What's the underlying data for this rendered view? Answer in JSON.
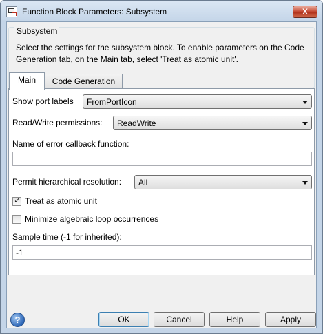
{
  "window": {
    "title": "Function Block Parameters: Subsystem",
    "close_glyph": "X"
  },
  "group": {
    "title": "Subsystem",
    "description": "Select the settings for the subsystem block. To enable parameters on the Code Generation tab, on the Main tab, select 'Treat as atomic unit'."
  },
  "tabs": [
    {
      "label": "Main",
      "active": true
    },
    {
      "label": "Code Generation",
      "active": false
    }
  ],
  "main": {
    "show_port_labels": {
      "label": "Show port labels",
      "value": "FromPortIcon"
    },
    "read_write_permissions": {
      "label": "Read/Write permissions:",
      "value": "ReadWrite"
    },
    "error_callback": {
      "label": "Name of error callback function:",
      "value": ""
    },
    "hierarchical_resolution": {
      "label": "Permit hierarchical resolution:",
      "value": "All"
    },
    "treat_atomic": {
      "label": "Treat as atomic unit",
      "checked": true
    },
    "minimize_loop": {
      "label": "Minimize algebraic loop occurrences",
      "checked": false
    },
    "sample_time": {
      "label": "Sample time (-1 for inherited):",
      "value": "-1"
    }
  },
  "buttons": {
    "help_glyph": "?",
    "ok": "OK",
    "cancel": "Cancel",
    "help": "Help",
    "apply": "Apply"
  },
  "colors": {
    "frame": "#c4d5e8",
    "close_button": "#c8513b",
    "dialog_bg": "#f0f0f0"
  }
}
